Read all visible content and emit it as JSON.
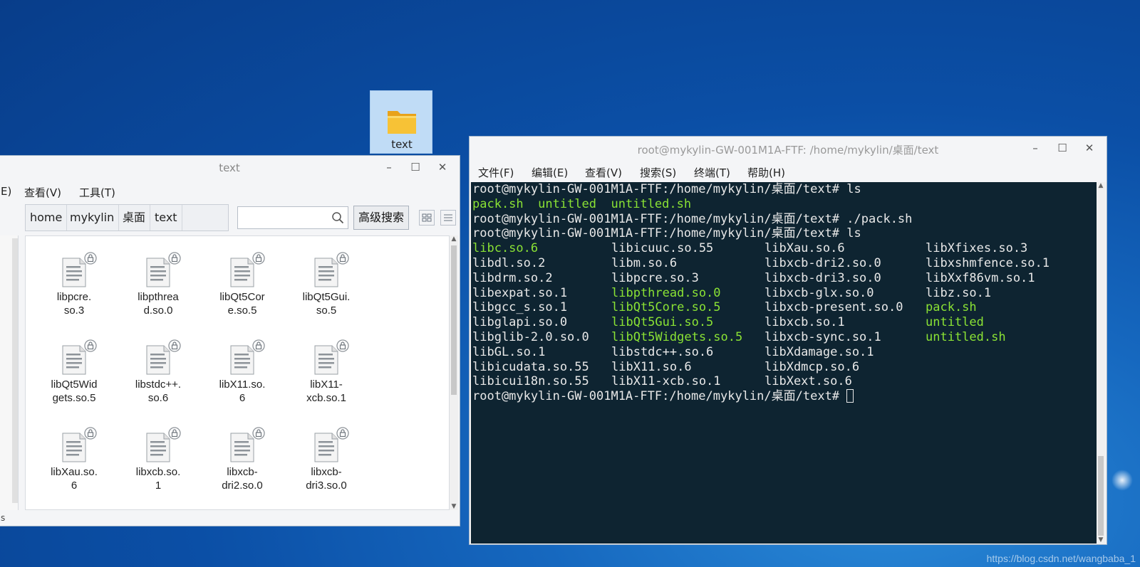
{
  "desktop": {
    "folder_label": "text",
    "watermark": "https://blog.csdn.net/wangbaba_1"
  },
  "file_manager": {
    "title": "text",
    "menu": [
      "E)",
      "查看(V)",
      "工具(T)"
    ],
    "breadcrumbs": [
      "home",
      "mykylin",
      "桌面",
      "text"
    ],
    "search_placeholder": "",
    "advanced_search": "高级搜索",
    "status_fragment": "s",
    "files": [
      {
        "name": "libpcre.so.3",
        "lines": [
          "libpcre.",
          "so.3"
        ]
      },
      {
        "name": "libpthread.so.0",
        "lines": [
          "libpthrea",
          "d.so.0"
        ]
      },
      {
        "name": "libQt5Core.so.5",
        "lines": [
          "libQt5Cor",
          "e.so.5"
        ]
      },
      {
        "name": "libQt5Gui.so.5",
        "lines": [
          "libQt5Gui.",
          "so.5"
        ]
      },
      {
        "name": "libQt5Widgets.so.5",
        "lines": [
          "libQt5Wid",
          "gets.so.5"
        ]
      },
      {
        "name": "libstdc++.so.6",
        "lines": [
          "libstdc++.",
          "so.6"
        ]
      },
      {
        "name": "libX11.so.6",
        "lines": [
          "libX11.so.",
          "6"
        ]
      },
      {
        "name": "libX11-xcb.so.1",
        "lines": [
          "libX11-",
          "xcb.so.1"
        ]
      },
      {
        "name": "libXau.so.6",
        "lines": [
          "libXau.so.",
          "6"
        ]
      },
      {
        "name": "libxcb.so.1",
        "lines": [
          "libxcb.so.",
          "1"
        ]
      },
      {
        "name": "libxcb-dri2.so.0",
        "lines": [
          "libxcb-",
          "dri2.so.0"
        ]
      },
      {
        "name": "libxcb-dri3.so.0",
        "lines": [
          "libxcb-",
          "dri3.so.0"
        ]
      }
    ]
  },
  "terminal": {
    "title": "root@mykylin-GW-001M1A-FTF: /home/mykylin/桌面/text",
    "menu": [
      "文件(F)",
      "编辑(E)",
      "查看(V)",
      "搜索(S)",
      "终端(T)",
      "帮助(H)"
    ],
    "prompt": "root@mykylin-GW-001M1A-FTF:/home/mykylin/桌面/text# ",
    "cmd1": "ls",
    "ls1": [
      "pack.sh",
      "untitled",
      "untitled.sh"
    ],
    "cmd2": "./pack.sh",
    "cmd3": "ls",
    "ls2_columns": [
      [
        {
          "t": "libc.so.6",
          "g": true
        },
        {
          "t": "libdl.so.2"
        },
        {
          "t": "libdrm.so.2"
        },
        {
          "t": "libexpat.so.1"
        },
        {
          "t": "libgcc_s.so.1"
        },
        {
          "t": "libglapi.so.0"
        },
        {
          "t": "libglib-2.0.so.0"
        },
        {
          "t": "libGL.so.1"
        },
        {
          "t": "libicudata.so.55"
        },
        {
          "t": "libicui18n.so.55"
        }
      ],
      [
        {
          "t": "libicuuc.so.55"
        },
        {
          "t": "libm.so.6"
        },
        {
          "t": "libpcre.so.3"
        },
        {
          "t": "libpthread.so.0",
          "g": true
        },
        {
          "t": "libQt5Core.so.5",
          "g": true
        },
        {
          "t": "libQt5Gui.so.5",
          "g": true
        },
        {
          "t": "libQt5Widgets.so.5",
          "g": true
        },
        {
          "t": "libstdc++.so.6"
        },
        {
          "t": "libX11.so.6"
        },
        {
          "t": "libX11-xcb.so.1"
        }
      ],
      [
        {
          "t": "libXau.so.6"
        },
        {
          "t": "libxcb-dri2.so.0"
        },
        {
          "t": "libxcb-dri3.so.0"
        },
        {
          "t": "libxcb-glx.so.0"
        },
        {
          "t": "libxcb-present.so.0"
        },
        {
          "t": "libxcb.so.1"
        },
        {
          "t": "libxcb-sync.so.1"
        },
        {
          "t": "libXdamage.so.1"
        },
        {
          "t": "libXdmcp.so.6"
        },
        {
          "t": "libXext.so.6"
        }
      ],
      [
        {
          "t": "libXfixes.so.3"
        },
        {
          "t": "libxshmfence.so.1"
        },
        {
          "t": "libXxf86vm.so.1"
        },
        {
          "t": "libz.so.1"
        },
        {
          "t": "pack.sh",
          "g": true
        },
        {
          "t": "untitled",
          "g": true
        },
        {
          "t": "untitled.sh",
          "g": true
        }
      ]
    ],
    "colors": {
      "background": "#0e2431",
      "text": "#e8e8e8",
      "executable": "#8ae234"
    }
  }
}
